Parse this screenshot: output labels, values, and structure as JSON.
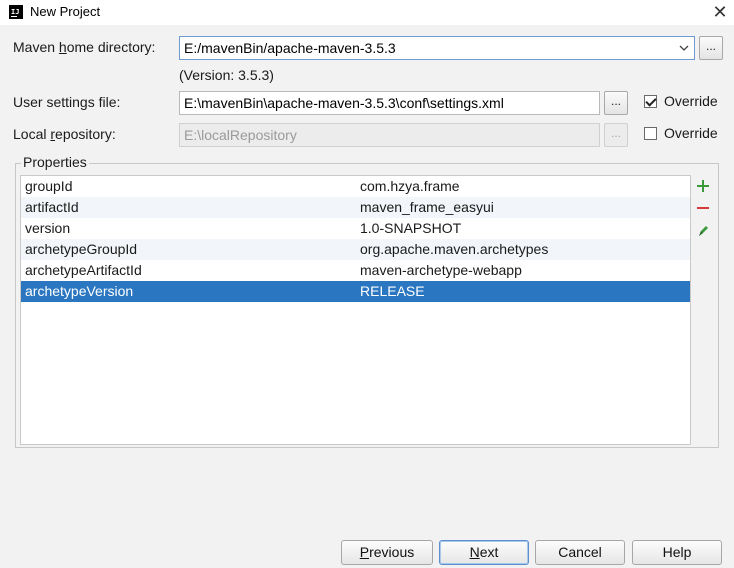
{
  "window": {
    "title": "New Project",
    "app_icon_text": "IJ",
    "close_glyph": "✕"
  },
  "form": {
    "maven_home": {
      "label_pre": "Maven ",
      "label_mnemonic": "h",
      "label_post": "ome directory:",
      "value": "E:/mavenBin/apache-maven-3.5.3",
      "version_note": "(Version: 3.5.3)",
      "browse_label": "..."
    },
    "user_settings": {
      "label": "User settings file:",
      "value": "E:\\mavenBin\\apache-maven-3.5.3\\conf\\settings.xml",
      "browse_label": "...",
      "override_label": "Override",
      "override_checked": true
    },
    "local_repo": {
      "label_pre": "Local ",
      "label_mnemonic": "r",
      "label_post": "epository:",
      "value": "E:\\localRepository",
      "browse_label": "...",
      "override_label": "Override",
      "override_checked": false
    }
  },
  "properties": {
    "title": "Properties",
    "rows": [
      {
        "key": "groupId",
        "value": "com.hzya.frame"
      },
      {
        "key": "artifactId",
        "value": "maven_frame_easyui"
      },
      {
        "key": "version",
        "value": "1.0-SNAPSHOT"
      },
      {
        "key": "archetypeGroupId",
        "value": "org.apache.maven.archetypes"
      },
      {
        "key": "archetypeArtifactId",
        "value": "maven-archetype-webapp"
      },
      {
        "key": "archetypeVersion",
        "value": "RELEASE"
      }
    ],
    "selected_index": 5,
    "actions": [
      "add-icon",
      "remove-icon",
      "edit-icon"
    ]
  },
  "buttons": {
    "previous_mnemonic": "P",
    "previous_rest": "revious",
    "next_mnemonic": "N",
    "next_rest": "ext",
    "cancel": "Cancel",
    "help": "Help"
  },
  "colors": {
    "selection": "#2b76c0",
    "add": "#3a9a3a",
    "remove": "#d43b3b",
    "edit": "#3a9a3a"
  }
}
